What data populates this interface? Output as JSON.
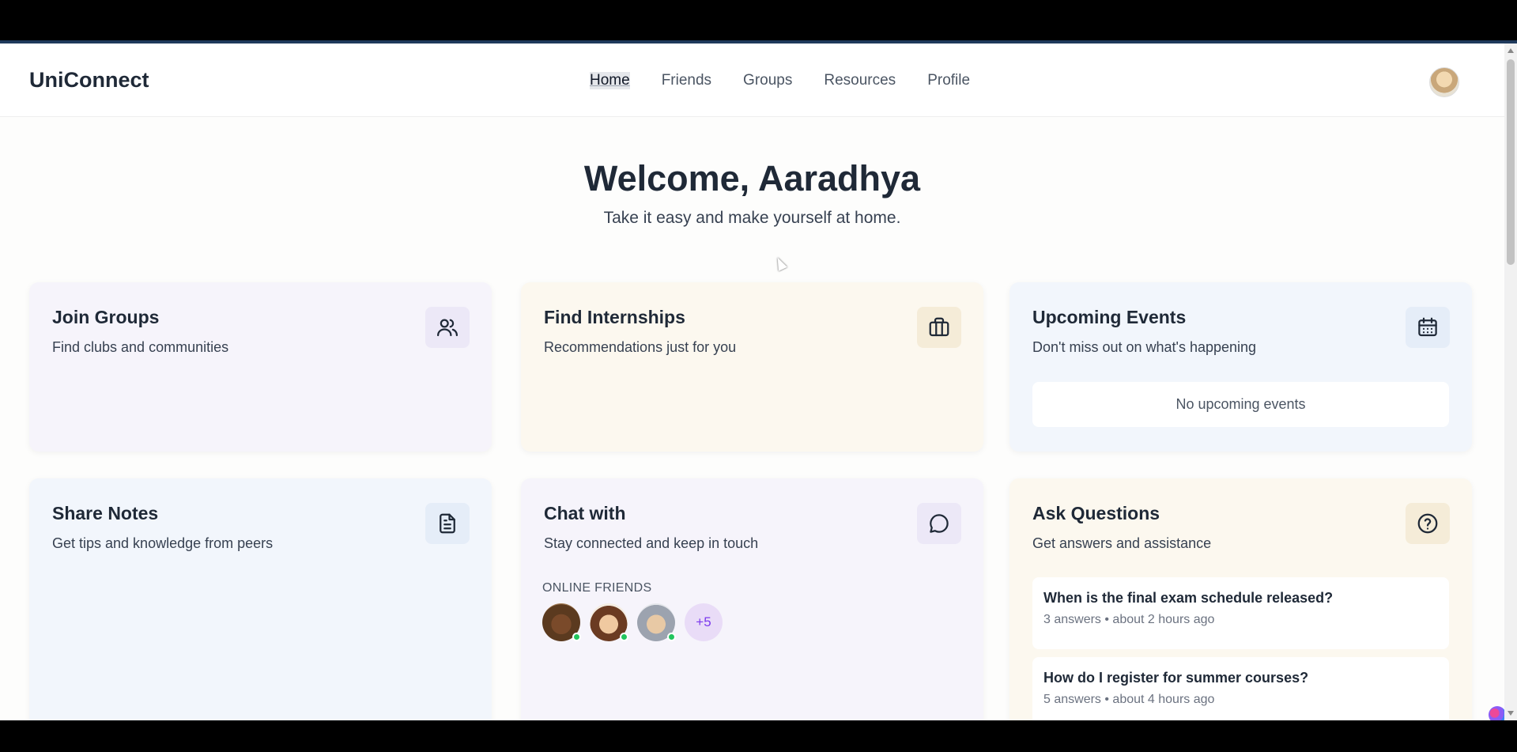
{
  "app": {
    "name": "UniConnect"
  },
  "nav": {
    "items": [
      {
        "label": "Home",
        "active": true
      },
      {
        "label": "Friends"
      },
      {
        "label": "Groups"
      },
      {
        "label": "Resources"
      },
      {
        "label": "Profile"
      }
    ]
  },
  "hero": {
    "title": "Welcome, Aaradhya",
    "subtitle": "Take it easy and make yourself at home."
  },
  "cards": {
    "join_groups": {
      "title": "Join Groups",
      "desc": "Find clubs and communities",
      "icon": "users-icon"
    },
    "internships": {
      "title": "Find Internships",
      "desc": "Recommendations just for you",
      "icon": "briefcase-icon"
    },
    "events": {
      "title": "Upcoming Events",
      "desc": "Don't miss out on what's happening",
      "icon": "calendar-icon",
      "empty": "No upcoming events"
    },
    "notes": {
      "title": "Share Notes",
      "desc": "Get tips and knowledge from peers",
      "icon": "document-icon"
    },
    "chat": {
      "title": "Chat with",
      "desc": "Stay connected and keep in touch",
      "icon": "chat-bubble-icon",
      "online_label": "ONLINE FRIENDS",
      "more": "+5"
    },
    "questions": {
      "title": "Ask Questions",
      "desc": "Get answers and assistance",
      "icon": "question-circle-icon",
      "items": [
        {
          "title": "When is the final exam schedule released?",
          "meta": "3 answers • about 2 hours ago"
        },
        {
          "title": "How do I register for summer courses?",
          "meta": "5 answers • about 4 hours ago"
        }
      ]
    }
  },
  "colors": {
    "purple_card": "#f6f4fb",
    "orange_card": "#fcf8ef",
    "blue_card": "#f2f6fc",
    "online_dot": "#22c55e",
    "more_badge": "#e9dcf7"
  }
}
